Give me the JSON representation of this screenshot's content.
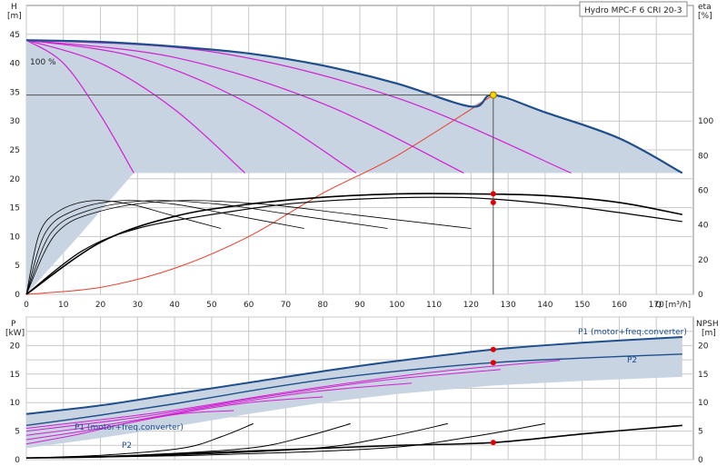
{
  "chart_data": [
    {
      "type": "line",
      "title": "Hydro MPC-F 6 CRI 20-3",
      "ylabel": "H",
      "yunit": "[m]",
      "y2label": "eta",
      "y2unit": "[%]",
      "xlabel": "Q",
      "xunit": "[m³/h]",
      "xlim": [
        0,
        180
      ],
      "ylim": [
        0,
        50
      ],
      "y2lim": [
        0,
        166.7
      ],
      "xticks": [
        0,
        10,
        20,
        30,
        40,
        50,
        60,
        70,
        80,
        90,
        100,
        110,
        120,
        130,
        140,
        150,
        160,
        170
      ],
      "yticks": [
        0,
        5,
        10,
        15,
        20,
        25,
        30,
        35,
        40,
        45
      ],
      "y2ticks": [
        0,
        20,
        40,
        60,
        80,
        100
      ],
      "speed_label": "100 %",
      "grid": true,
      "max_speed_curve": {
        "x": [
          0,
          20,
          40,
          60,
          80,
          100,
          120,
          126,
          140,
          160,
          177
        ],
        "y": [
          44,
          43.7,
          42.9,
          41.7,
          39.6,
          36.5,
          32.5,
          34.5,
          31.5,
          27.0,
          21.0
        ]
      },
      "reduced_speed_curves": [
        {
          "x": [
            0,
            10,
            20,
            29
          ],
          "y": [
            44,
            40,
            31,
            21
          ]
        },
        {
          "x": [
            0,
            20,
            40,
            59
          ],
          "y": [
            44,
            40,
            32,
            21
          ]
        },
        {
          "x": [
            0,
            30,
            60,
            89
          ],
          "y": [
            44,
            41,
            33,
            21
          ]
        },
        {
          "x": [
            0,
            40,
            80,
            118
          ],
          "y": [
            44,
            41,
            33,
            21
          ]
        },
        {
          "x": [
            0,
            50,
            100,
            147
          ],
          "y": [
            44,
            42,
            34,
            21
          ]
        }
      ],
      "efficiency_curves": [
        {
          "x": [
            0,
            20,
            40,
            60,
            80,
            100,
            120,
            140,
            160,
            177
          ],
          "y": [
            0,
            30,
            45,
            52,
            56,
            58,
            58,
            57,
            53,
            46
          ]
        },
        {
          "x": [
            0,
            15,
            30,
            50,
            70,
            90,
            110,
            126,
            150,
            177
          ],
          "y": [
            0,
            25,
            38,
            46,
            52,
            55,
            56,
            55,
            50,
            42
          ]
        }
      ],
      "system_curve": {
        "x": [
          0,
          20,
          40,
          60,
          80,
          100,
          126
        ],
        "y": [
          0,
          1.2,
          4.5,
          10,
          17.5,
          24,
          34.5
        ]
      },
      "duty_point": {
        "x": 126,
        "y": 34.5
      },
      "eta_points": [
        {
          "x": 126,
          "eta": 58
        },
        {
          "x": 126,
          "eta": 53
        }
      ]
    },
    {
      "type": "line",
      "ylabel": "P",
      "yunit": "[kW]",
      "y2label": "NPSH",
      "y2unit": "[m]",
      "xlim": [
        0,
        180
      ],
      "ylim": [
        0,
        25
      ],
      "yticks": [
        0,
        5,
        10,
        15,
        20
      ],
      "y2ticks": [
        0,
        5,
        10,
        15,
        20
      ],
      "grid": true,
      "series_labels": [
        "P1 (motor+freq.converter)",
        "P2",
        "P1 (motor+freq.converter)",
        "P2"
      ],
      "p1_curve": {
        "x": [
          0,
          20,
          40,
          60,
          80,
          100,
          126,
          150,
          177
        ],
        "y": [
          8,
          9.5,
          11.5,
          13.5,
          15.5,
          17.3,
          19.3,
          20.5,
          21.5
        ]
      },
      "p2_curve": {
        "x": [
          0,
          20,
          40,
          60,
          80,
          100,
          126,
          150,
          177
        ],
        "y": [
          6,
          7.8,
          9.8,
          12,
          14,
          15.5,
          17,
          17.8,
          18.5
        ]
      },
      "npsh_curve": {
        "x": [
          0,
          20,
          40,
          60,
          80,
          100,
          126,
          150,
          177
        ],
        "y": [
          0.3,
          0.5,
          1,
          1.5,
          2,
          2.5,
          3,
          4.5,
          6
        ]
      },
      "duty_points": [
        {
          "x": 126,
          "y": 19.3
        },
        {
          "x": 126,
          "y": 17
        },
        {
          "x": 126,
          "y": 3
        }
      ]
    }
  ]
}
